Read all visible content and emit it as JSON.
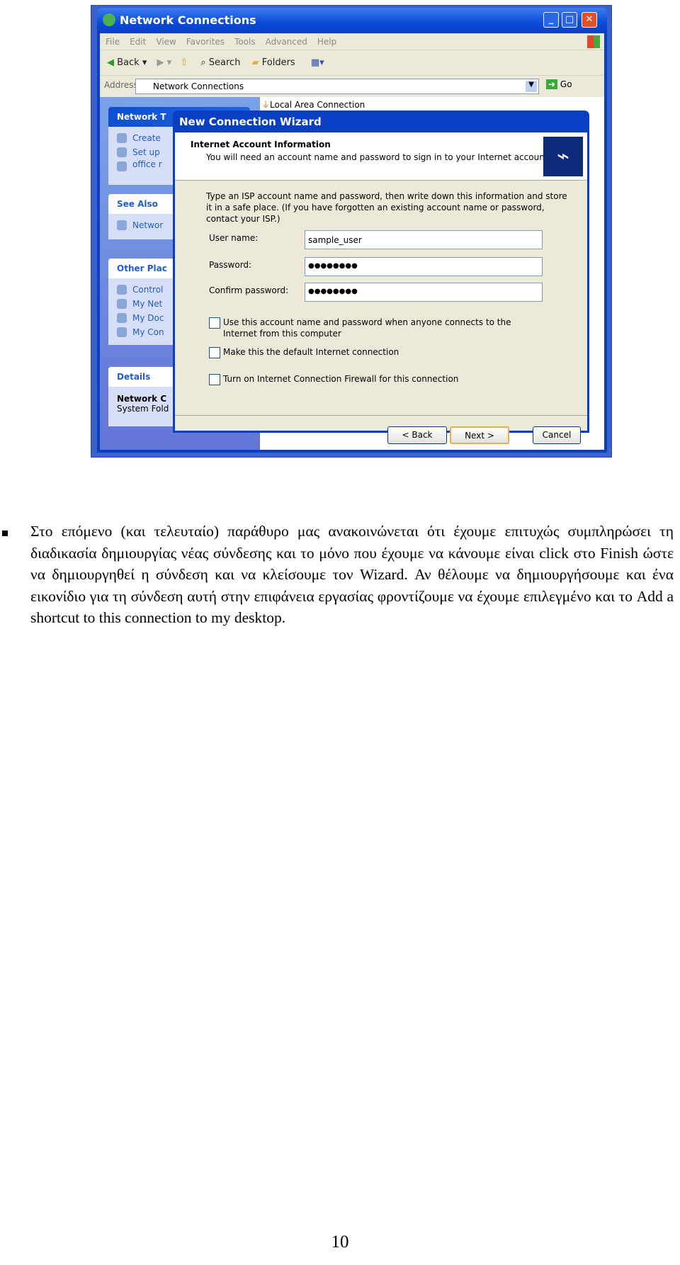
{
  "window": {
    "title": "Network Connections",
    "menu": [
      "File",
      "Edit",
      "View",
      "Favorites",
      "Tools",
      "Advanced",
      "Help"
    ],
    "toolbar": {
      "back": "Back",
      "search": "Search",
      "folders": "Folders"
    },
    "address": {
      "label": "Address",
      "value": "Network Connections",
      "go": "Go"
    },
    "left_pane": {
      "network_tasks": {
        "title": "Network T",
        "items": [
          "Create",
          "Set up",
          "office r"
        ]
      },
      "see_also": {
        "title": "See Also",
        "items": [
          "Networ"
        ]
      },
      "other_places": {
        "title": "Other Plac",
        "items": [
          "Control",
          "My Net",
          "My Doc",
          "My Con"
        ]
      },
      "details": {
        "title": "Details",
        "name": "Network C",
        "type": "System Fold"
      }
    },
    "right_pane": {
      "item": "Local Area Connection"
    }
  },
  "wizard": {
    "title": "New Connection Wizard",
    "header": "Internet Account Information",
    "subheader": "You will need an account name and password to sign in to your Internet account.",
    "intro": "Type an ISP account name and password, then write down this information and store it in a safe place. (If you have forgotten an existing account name or password, contact your ISP.)",
    "fields": [
      {
        "label": "User name:",
        "value": "sample_user"
      },
      {
        "label": "Password:",
        "value": "●●●●●●●●"
      },
      {
        "label": "Confirm password:",
        "value": "●●●●●●●●"
      }
    ],
    "checkboxes": [
      {
        "label": "Use this account  name and password when anyone connects to the Internet from this computer",
        "checked": false
      },
      {
        "label": "Make this the default Internet connection",
        "checked": false
      },
      {
        "label": "Turn on Internet Connection Firewall for this connection",
        "checked": false
      }
    ],
    "buttons": {
      "back": "< Back",
      "next": "Next >",
      "cancel": "Cancel"
    }
  },
  "document": {
    "paragraph": "Στο επόμενο (και τελευταίο) παράθυρο μας ανακοινώνεται ότι έχουμε επιτυχώς συμπληρώσει τη διαδικασία δημιουργίας νέας σύνδεσης και το μόνο που έχουμε να κάνουμε είναι click στο Finish ώστε να δημιουργηθεί η σύνδεση και να κλείσουμε τον Wizard. Αν θέλουμε να δημιουργήσουμε και ένα εικονίδιο για τη σύνδεση αυτή στην επιφάνεια εργασίας φροντίζουμε να έχουμε επιλεγμένο και το Add a shortcut to this connection to my desktop.",
    "page_number": "10"
  }
}
